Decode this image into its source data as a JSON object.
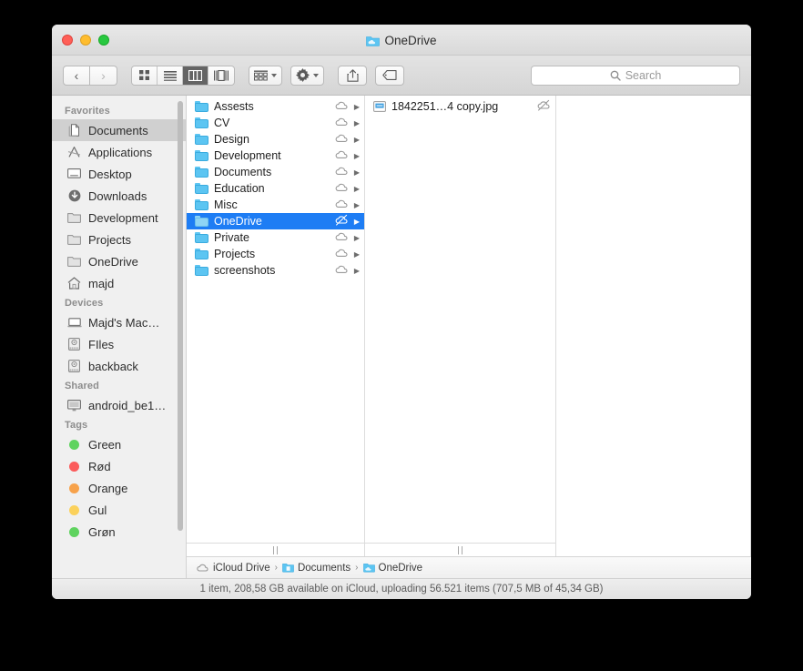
{
  "window": {
    "title": "OneDrive",
    "title_icon": "onedrive-folder-icon",
    "traffic_lights": [
      {
        "name": "close-button",
        "color": "#ff5f57"
      },
      {
        "name": "minimize-button",
        "color": "#ffbd2e"
      },
      {
        "name": "maximize-button",
        "color": "#28c840"
      }
    ]
  },
  "toolbar": {
    "back_icon": "chevron-left-icon",
    "forward_icon": "chevron-right-icon",
    "view_modes": [
      {
        "name": "icon-view",
        "icon": "grid-icon",
        "active": false
      },
      {
        "name": "list-view",
        "icon": "lines-icon",
        "active": false
      },
      {
        "name": "column-view",
        "icon": "columns-icon",
        "active": true
      },
      {
        "name": "gallery-view",
        "icon": "gallery-icon",
        "active": false
      }
    ],
    "arrange_icon": "arrange-icon",
    "action_icon": "gear-icon",
    "share_icon": "share-icon",
    "tag_icon": "tag-icon"
  },
  "search": {
    "placeholder": "Search",
    "icon": "search-icon",
    "value": ""
  },
  "sidebar": {
    "sections": [
      {
        "header": "Favorites",
        "items": [
          {
            "label": "Documents",
            "icon": "documents-icon",
            "selected": true
          },
          {
            "label": "Applications",
            "icon": "applications-icon",
            "selected": false
          },
          {
            "label": "Desktop",
            "icon": "desktop-icon",
            "selected": false
          },
          {
            "label": "Downloads",
            "icon": "downloads-icon",
            "selected": false
          },
          {
            "label": "Development",
            "icon": "folder-icon",
            "selected": false
          },
          {
            "label": "Projects",
            "icon": "folder-icon",
            "selected": false
          },
          {
            "label": "OneDrive",
            "icon": "folder-icon",
            "selected": false
          },
          {
            "label": "majd",
            "icon": "home-icon",
            "selected": false
          }
        ]
      },
      {
        "header": "Devices",
        "items": [
          {
            "label": "Majd's Mac…",
            "icon": "laptop-icon",
            "selected": false
          },
          {
            "label": "FIles",
            "icon": "harddisk-icon",
            "selected": false
          },
          {
            "label": "backback",
            "icon": "harddisk-icon",
            "selected": false
          }
        ]
      },
      {
        "header": "Shared",
        "items": [
          {
            "label": "android_be1…",
            "icon": "display-icon",
            "selected": false
          }
        ]
      },
      {
        "header": "Tags",
        "items": [
          {
            "label": "Green",
            "icon": "tag-dot-icon",
            "color": "#5fd35f",
            "selected": false
          },
          {
            "label": "Rød",
            "icon": "tag-dot-icon",
            "color": "#fb5b5b",
            "selected": false
          },
          {
            "label": "Orange",
            "icon": "tag-dot-icon",
            "color": "#f7a24b",
            "selected": false
          },
          {
            "label": "Gul",
            "icon": "tag-dot-icon",
            "color": "#fbd15b",
            "selected": false
          },
          {
            "label": "Grøn",
            "icon": "tag-dot-icon",
            "color": "#5fd35f",
            "selected": false
          }
        ]
      }
    ]
  },
  "columns": [
    {
      "name": "column-folders",
      "rows": [
        {
          "label": "Assests",
          "icon": "folder-icon",
          "status": "cloud-icon",
          "chevron": true,
          "selected": false
        },
        {
          "label": "CV",
          "icon": "folder-icon",
          "status": "cloud-icon",
          "chevron": true,
          "selected": false
        },
        {
          "label": "Design",
          "icon": "folder-icon",
          "status": "cloud-icon",
          "chevron": true,
          "selected": false
        },
        {
          "label": "Development",
          "icon": "folder-icon",
          "status": "cloud-icon",
          "chevron": true,
          "selected": false
        },
        {
          "label": "Documents",
          "icon": "folder-icon",
          "status": "cloud-icon",
          "chevron": true,
          "selected": false
        },
        {
          "label": "Education",
          "icon": "folder-icon",
          "status": "cloud-icon",
          "chevron": true,
          "selected": false
        },
        {
          "label": "Misc",
          "icon": "folder-icon",
          "status": "cloud-icon",
          "chevron": true,
          "selected": false
        },
        {
          "label": "OneDrive",
          "icon": "onedrive-folder-icon",
          "status": "cloud-slash-icon",
          "chevron": true,
          "selected": true
        },
        {
          "label": "Private",
          "icon": "folder-icon",
          "status": "cloud-icon",
          "chevron": true,
          "selected": false
        },
        {
          "label": "Projects",
          "icon": "folder-icon",
          "status": "cloud-icon",
          "chevron": true,
          "selected": false
        },
        {
          "label": "screenshots",
          "icon": "folder-icon",
          "status": "cloud-icon",
          "chevron": true,
          "selected": false
        }
      ]
    },
    {
      "name": "column-contents",
      "rows": [
        {
          "label": "1842251…4 copy.jpg",
          "icon": "jpg-file-icon",
          "status": "cloud-slash-icon",
          "chevron": false,
          "selected": false
        }
      ]
    },
    {
      "name": "column-preview",
      "rows": []
    }
  ],
  "breadcrumb": [
    {
      "label": "iCloud Drive",
      "icon": "cloud-icon"
    },
    {
      "label": "Documents",
      "icon": "documents-folder-icon"
    },
    {
      "label": "OneDrive",
      "icon": "onedrive-folder-icon"
    }
  ],
  "breadcrumb_separator": "›",
  "statusbar": {
    "text": "1 item, 208,58 GB available on iCloud, uploading 56.521 items (707,5 MB of 45,34 GB)"
  },
  "colors": {
    "selection_blue": "#1e7df4",
    "sidebar_bg": "#f0f0f0",
    "folder_blue": "#5cc5f2"
  }
}
